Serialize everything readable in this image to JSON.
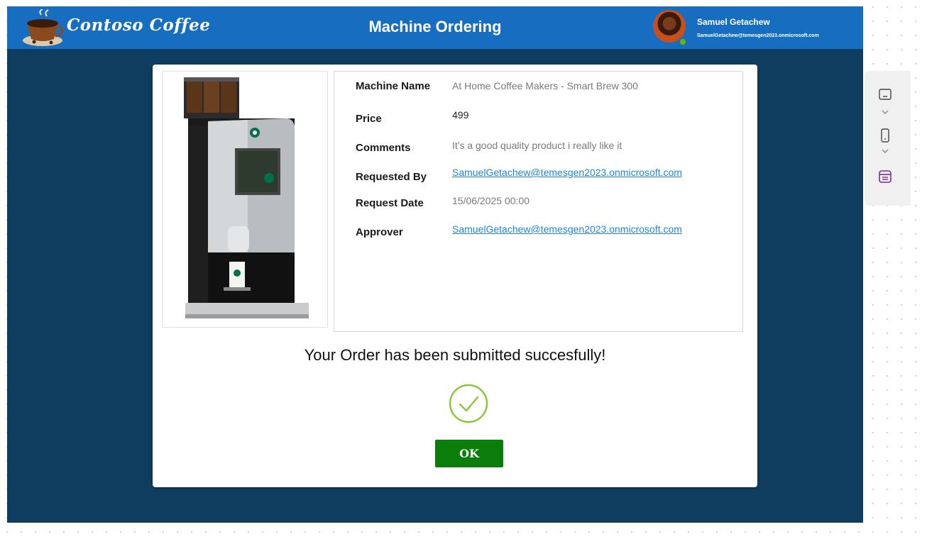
{
  "header": {
    "brand": "Contoso Coffee",
    "title": "Machine Ordering",
    "user_name": "Samuel Getachew",
    "user_email": "SamuelGetachew@temesgen2023.onmicrosoft.com"
  },
  "details": [
    {
      "label": "Machine Name",
      "value": "At Home Coffee Makers - Smart Brew 300",
      "style": "muted"
    },
    {
      "label": "Price",
      "value": "499",
      "style": "dark"
    },
    {
      "label": "Comments",
      "value": "It's a good quality product i really like it",
      "style": "muted"
    },
    {
      "label": "Requested By",
      "value": "SamuelGetachew@temesgen2023.onmicrosoft.com",
      "style": "link"
    },
    {
      "label": "Request Date",
      "value": "15/06/2025 00:00",
      "style": "muted"
    },
    {
      "label": "Approver",
      "value": "SamuelGetachew@temesgen2023.onmicrosoft.com",
      "style": "link"
    }
  ],
  "success_message": "Your Order has been submitted succesfully!",
  "ok_label": "OK",
  "colors": {
    "header_bar": "#176ec1",
    "app_background": "#0f3d5f",
    "ok_button": "#0a7d0a",
    "check": "#8cc63f",
    "link": "#1e86d9"
  },
  "icons": [
    "coffee-cup-logo-icon",
    "check-circle-icon",
    "tablet-layout-icon",
    "phone-layout-icon",
    "form-icon",
    "chevron-down-icon"
  ]
}
